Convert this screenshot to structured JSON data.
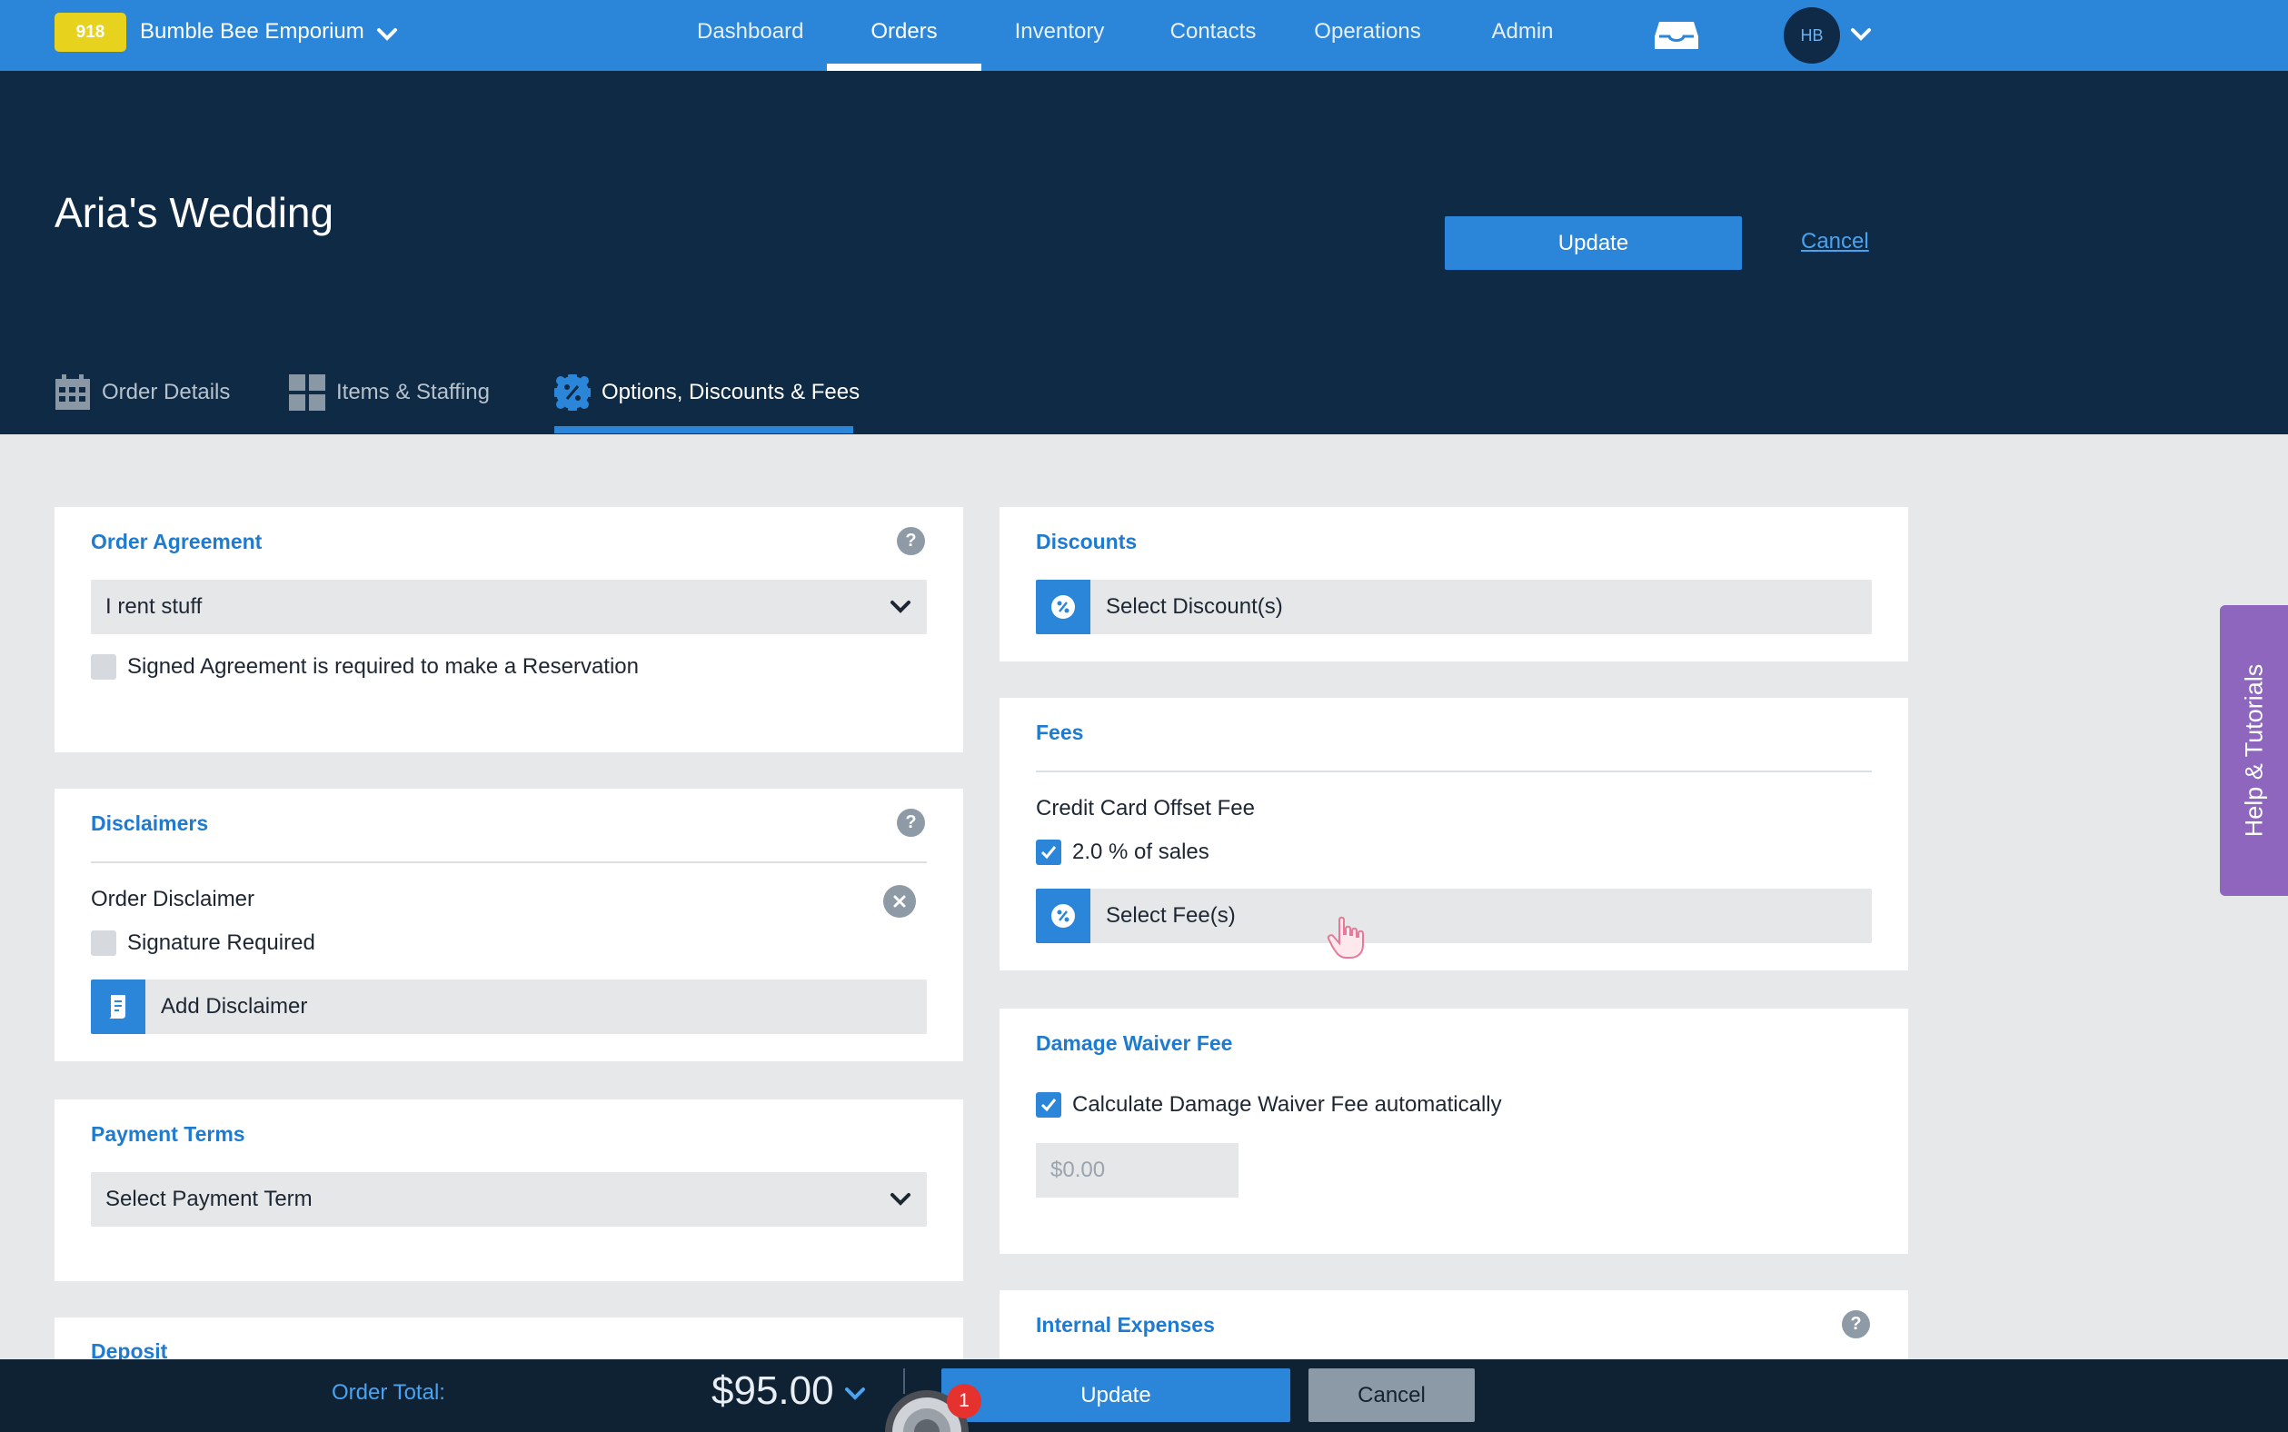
{
  "topnav": {
    "badge": "918",
    "business_name": "Bumble Bee Emporium",
    "links": [
      "Dashboard",
      "Orders",
      "Inventory",
      "Contacts",
      "Operations",
      "Admin"
    ],
    "active_link": "Orders",
    "avatar_initials": "HB",
    "accent_color": "#2b86d9"
  },
  "header": {
    "title": "Aria's Wedding",
    "update_label": "Update",
    "cancel_label": "Cancel",
    "background": "#0e2a44"
  },
  "tabs": [
    {
      "label": "Order Details",
      "icon": "calendar-icon"
    },
    {
      "label": "Items & Staffing",
      "icon": "grid-icon"
    },
    {
      "label": "Options, Discounts & Fees",
      "icon": "percent-badge-icon"
    }
  ],
  "active_tab": "Options, Discounts & Fees",
  "order_agreement": {
    "title": "Order Agreement",
    "selected": "I rent stuff",
    "signed_required_label": "Signed Agreement is required to make a Reservation",
    "signed_required_checked": false
  },
  "disclaimers": {
    "title": "Disclaimers",
    "items": [
      {
        "name": "Order Disclaimer",
        "signature_label": "Signature Required",
        "signature_checked": false
      }
    ],
    "add_label": "Add Disclaimer"
  },
  "payment_terms": {
    "title": "Payment Terms",
    "placeholder": "Select Payment Term"
  },
  "deposit": {
    "title": "Deposit"
  },
  "discounts": {
    "title": "Discounts",
    "select_label": "Select Discount(s)"
  },
  "fees": {
    "title": "Fees",
    "items": [
      {
        "name": "Credit Card Offset Fee",
        "detail": "2.0 % of sales",
        "checked": true
      }
    ],
    "select_label": "Select Fee(s)"
  },
  "damage_waiver": {
    "title": "Damage Waiver Fee",
    "auto_label": "Calculate Damage Waiver Fee automatically",
    "auto_checked": true,
    "amount_placeholder": "$0.00"
  },
  "internal_expenses": {
    "title": "Internal Expenses"
  },
  "help_tab": {
    "label": "Help & Tutorials",
    "color": "#8e66bd"
  },
  "bottombar": {
    "order_total_label": "Order Total:",
    "order_total_value": "$95.00",
    "update_label": "Update",
    "cancel_label": "Cancel",
    "notification_count": "1"
  }
}
